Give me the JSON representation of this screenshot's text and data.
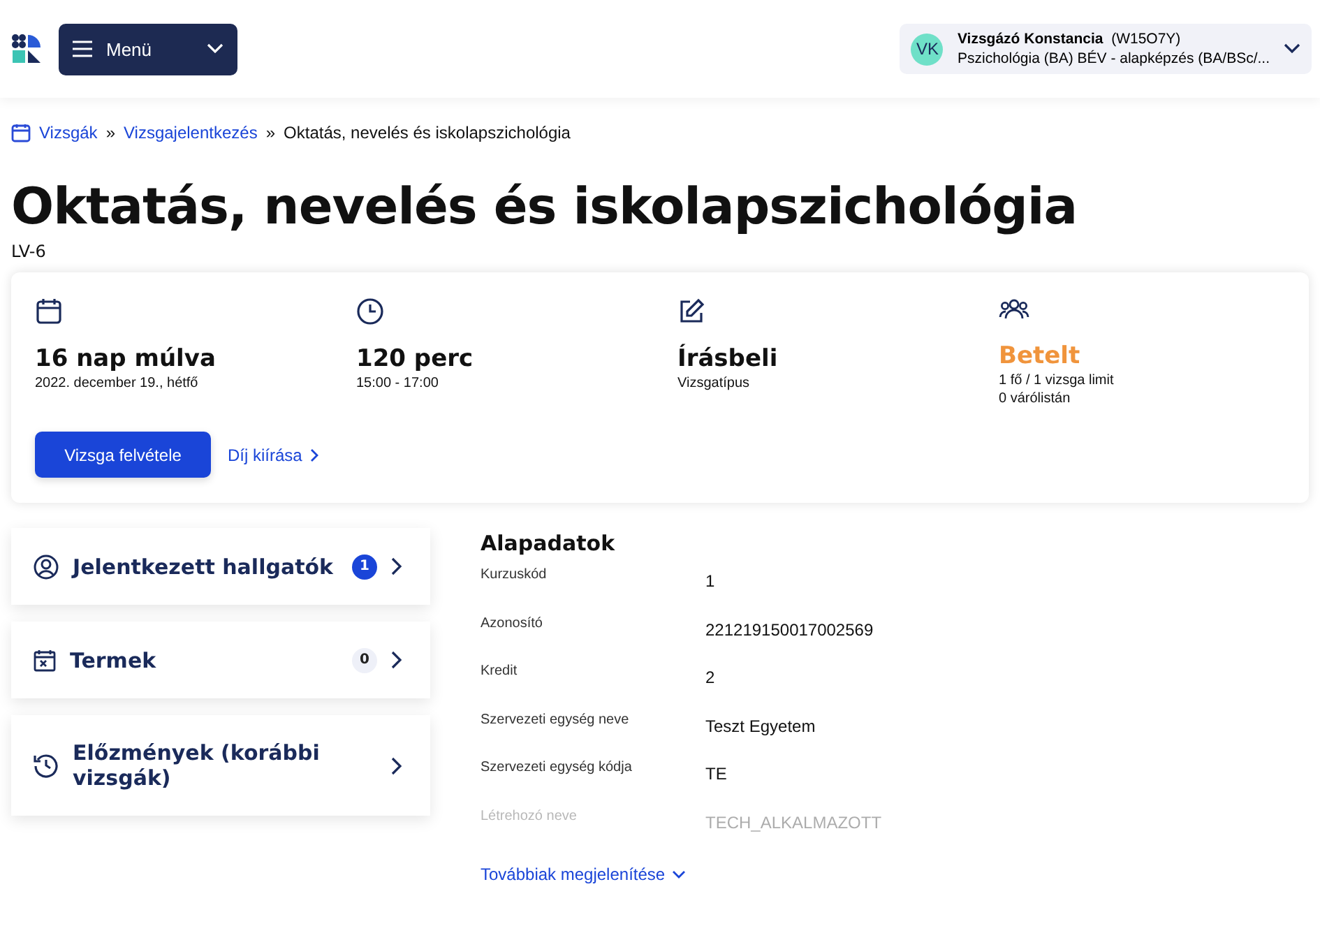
{
  "header": {
    "menu_label": "Menü",
    "user": {
      "initials": "VK",
      "name": "Vizsgázó Konstancia",
      "code": "(W15O7Y)",
      "program": "Pszichológia (BA) BÉV - alapképzés (BA/BSc/..."
    }
  },
  "breadcrumb": [
    {
      "label": "Vizsgák",
      "link": true
    },
    {
      "label": "Vizsgajelentkezés",
      "link": true
    },
    {
      "label": "Oktatás, nevelés és iskolapszichológia",
      "link": false
    }
  ],
  "breadcrumb_separator": "»",
  "title": "Oktatás, nevelés és iskolapszichológia",
  "subtitle": "LV-6",
  "summary": [
    {
      "kind": "calendar",
      "value": "16 nap múlva",
      "details": [
        "2022. december 19., hétfő"
      ],
      "accent": false
    },
    {
      "kind": "clock",
      "value": "120 perc",
      "details": [
        "15:00 - 17:00"
      ],
      "accent": false
    },
    {
      "kind": "edit",
      "value": "Írásbeli",
      "details": [
        "Vizsgatípus"
      ],
      "accent": false
    },
    {
      "kind": "people",
      "value": "Betelt",
      "details": [
        "1 fő / 1 vizsga limit",
        "0 várólistán"
      ],
      "accent": true
    }
  ],
  "primary_button": "Vizsga felvétele",
  "fee_link": "Díj kiírása",
  "side_cards": [
    {
      "kind": "person",
      "label": "Jelentkezett hallgatók",
      "count": "1",
      "highlighted": true
    },
    {
      "kind": "room",
      "label": "Termek",
      "count": "0",
      "highlighted": false
    },
    {
      "kind": "history",
      "label": "Előzmények (korábbi vizsgák)"
    }
  ],
  "details": {
    "heading": "Alapadatok",
    "rows": [
      {
        "label": "Kurzuskód",
        "value": "1",
        "faded": false
      },
      {
        "label": "Azonosító",
        "value": "221219150017002569",
        "faded": false
      },
      {
        "label": "Kredit",
        "value": "2",
        "faded": false
      },
      {
        "label": "Szervezeti egység neve",
        "value": "Teszt Egyetem",
        "faded": false
      },
      {
        "label": "Szervezeti egység kódja",
        "value": "TE",
        "faded": false
      },
      {
        "label": "Létrehozó neve",
        "value": "TECH_ALKALMAZOTT",
        "faded": true
      }
    ],
    "more_link": "Továbbiak megjelenítése"
  }
}
